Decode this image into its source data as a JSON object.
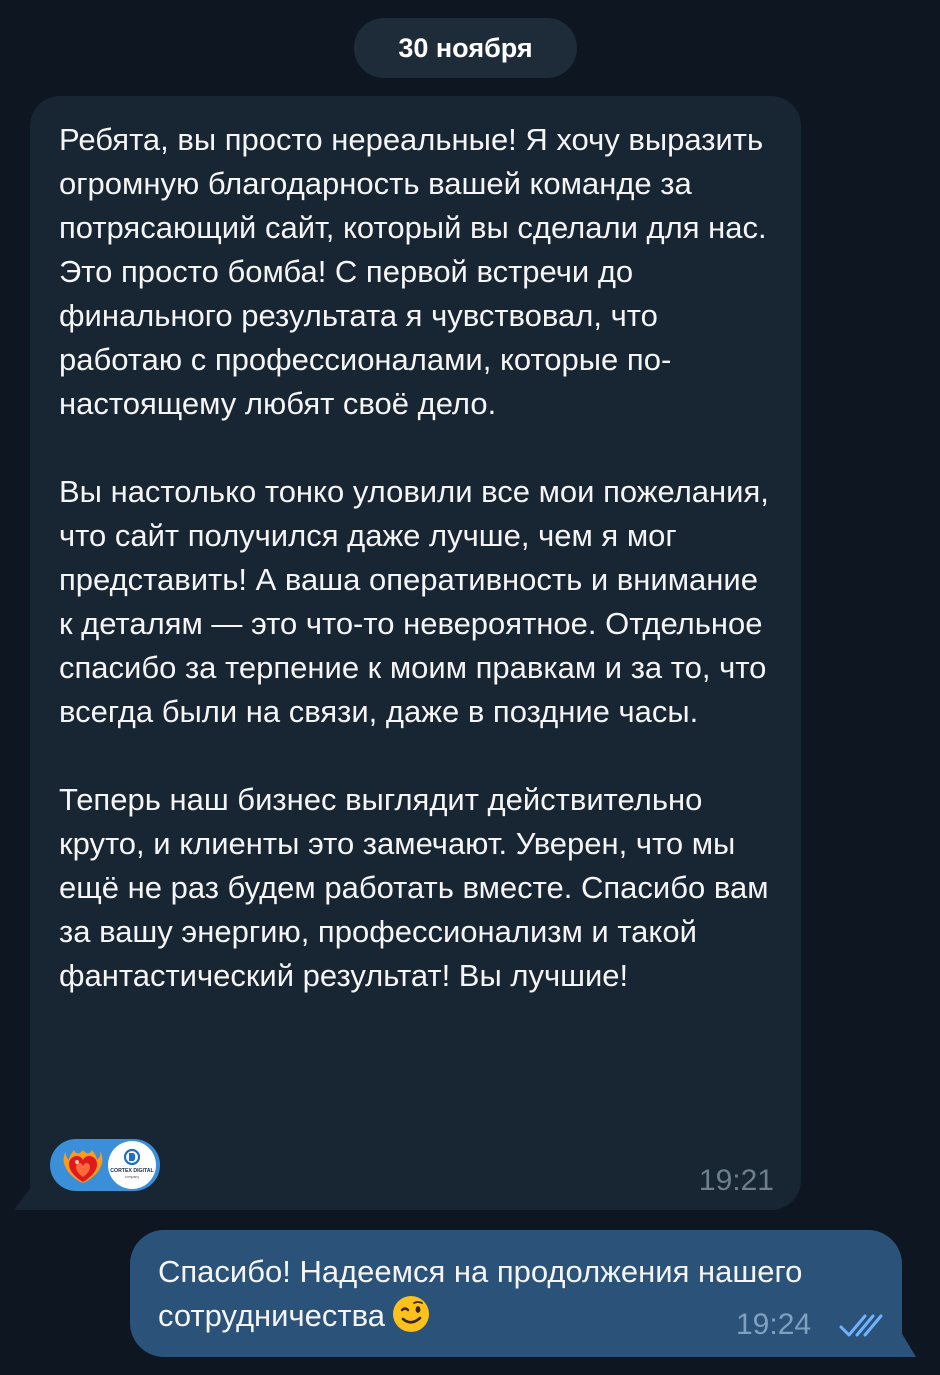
{
  "date_divider": "30 ноября",
  "incoming_message": {
    "paragraphs": [
      "Ребята, вы просто нереальные! Я хочу выразить огромную благодарность вашей команде за потрясающий сайт, который вы сделали для нас. Это просто бомба! С первой встречи до финального результата я чувствовал, что работаю с профессионалами, которые по-настоящему любят своё дело.",
      "Вы настолько тонко уловили все мои пожелания, что сайт получился даже лучше, чем я мог представить! А ваша оперативность и внимание к деталям — это что-то невероятное. Отдельное спасибо за терпение к моим правкам и за то, что всегда были на связи, даже в поздние часы.",
      "Теперь наш бизнес выглядит действительно круто, и клиенты это замечают. Уверен, что мы ещё не раз будем работать вместе. Спасибо вам за вашу энергию, профессионализм и такой фантастический результат! Вы лучшие!"
    ],
    "reaction": {
      "emoji_icon": "heart-on-fire-icon",
      "avatar_label": "CORTEX DIGITAL",
      "avatar_sublabel": "company"
    },
    "time": "19:21"
  },
  "outgoing_message": {
    "text": "Спасибо! Надеемся на продолжения нашего сотрудничества",
    "emoji_icon": "winking-face-icon",
    "time": "19:24",
    "status_icon": "double-check-icon"
  },
  "colors": {
    "background": "#0e1621",
    "incoming_bubble": "#182533",
    "outgoing_bubble": "#2b5278",
    "reaction_pill": "#3b8fd8",
    "read_checks": "#6fb3ff"
  }
}
